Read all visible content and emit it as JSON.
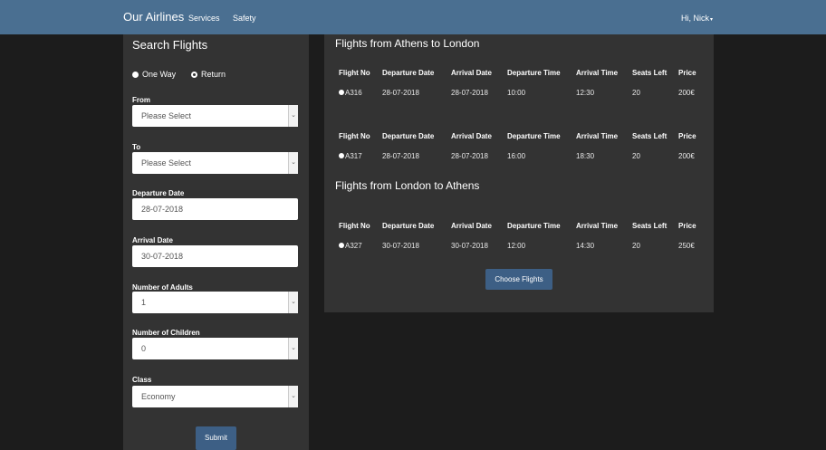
{
  "nav": {
    "brand": "Our Airlines",
    "services": "Services",
    "safety": "Safety",
    "user": "Hi, Nick"
  },
  "search": {
    "title": "Search Flights",
    "trip_types": [
      "One Way",
      "Return"
    ],
    "selected_trip_type": "One Way",
    "from_label": "From",
    "from_value": "Please Select",
    "to_label": "To",
    "to_value": "Please Select",
    "departure_label": "Departure Date",
    "departure_value": "28-07-2018",
    "arrival_label": "Arrival Date",
    "arrival_value": "30-07-2018",
    "adults_label": "Number of Adults",
    "adults_value": "1",
    "children_label": "Number of Children",
    "children_value": "0",
    "class_label": "Class",
    "class_value": "Economy",
    "submit_label": "Submit"
  },
  "results": {
    "outbound_title": "Flights from Athens to London",
    "return_title": "Flights from London to Athens",
    "headers": [
      "Flight No",
      "Departure Date",
      "Arrival Date",
      "Departure Time",
      "Arrival Time",
      "Seats Left",
      "Price"
    ],
    "outbound": [
      [
        "A316",
        "28-07-2018",
        "28-07-2018",
        "10:00",
        "12:30",
        "20",
        "200€"
      ],
      [
        "A317",
        "28-07-2018",
        "28-07-2018",
        "16:00",
        "18:30",
        "20",
        "200€"
      ]
    ],
    "return": [
      [
        "A327",
        "30-07-2018",
        "30-07-2018",
        "12:00",
        "14:30",
        "20",
        "250€"
      ]
    ],
    "choose_label": "Choose Flights"
  },
  "colors": {
    "navbar": "#4a6f91",
    "background": "#1c1c1c",
    "panel": "#333333",
    "button": "#3d5f85"
  }
}
